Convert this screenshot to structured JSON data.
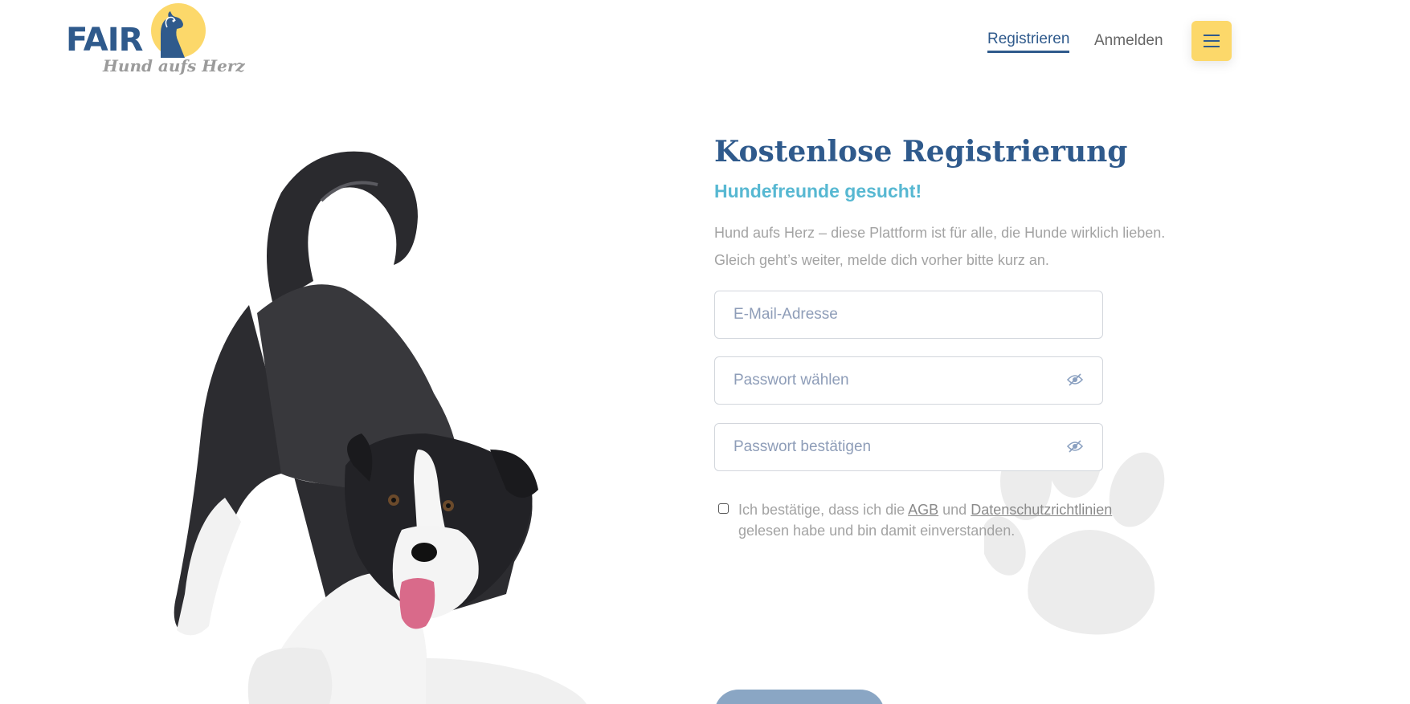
{
  "brand": {
    "name": "FAIR",
    "tagline": "Hund aufs Herz"
  },
  "nav": {
    "register": "Registrieren",
    "login": "Anmelden",
    "menu_icon": "hamburger-icon"
  },
  "form": {
    "title": "Kostenlose Registrierung",
    "subtitle": "Hundefreunde gesucht!",
    "intro": "Hund aufs Herz – diese Plattform ist für alle, die Hunde wirklich lieben. Gleich geht’s weiter, melde dich vorher bitte kurz an.",
    "email_placeholder": "E-Mail-Adresse",
    "password_placeholder": "Passwort wählen",
    "confirm_placeholder": "Passwort bestätigen",
    "consent": {
      "before": "Ich bestätige, dass ich die ",
      "agb_link": "AGB",
      "middle": " und ",
      "privacy_link": "Datenschutzrichtlinien",
      "after": " gelesen habe und bin damit einverstanden."
    }
  },
  "colors": {
    "brand_blue": "#2f5a8c",
    "accent_yellow": "#fcd86a",
    "subtitle_cyan": "#57b8d2",
    "button_disabled": "#8aa6c4"
  }
}
